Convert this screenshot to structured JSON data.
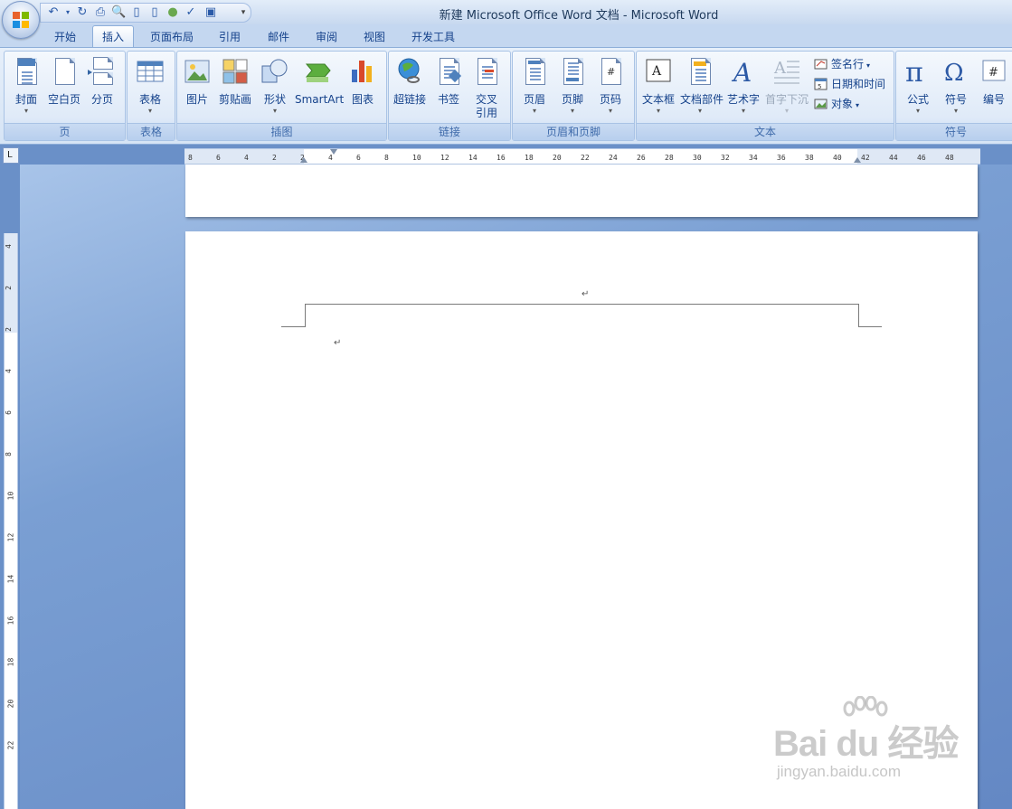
{
  "window": {
    "title": "新建 Microsoft Office Word 文档 - Microsoft Word"
  },
  "tabs": [
    {
      "label": "开始",
      "active": false
    },
    {
      "label": "插入",
      "active": true
    },
    {
      "label": "页面布局",
      "active": false
    },
    {
      "label": "引用",
      "active": false
    },
    {
      "label": "邮件",
      "active": false
    },
    {
      "label": "审阅",
      "active": false
    },
    {
      "label": "视图",
      "active": false
    },
    {
      "label": "开发工具",
      "active": false
    }
  ],
  "ribbon": {
    "groups": {
      "page": {
        "label": "页",
        "buttons": {
          "cover": "封面",
          "blank": "空白页",
          "break": "分页"
        }
      },
      "table": {
        "label": "表格",
        "buttons": {
          "table": "表格"
        }
      },
      "illustrations": {
        "label": "插图",
        "buttons": {
          "picture": "图片",
          "clipart": "剪贴画",
          "shapes": "形状",
          "smartart": "SmartArt",
          "chart": "图表"
        }
      },
      "links": {
        "label": "链接",
        "buttons": {
          "hyperlink": "超链接",
          "bookmark": "书签",
          "crossref_1": "交叉",
          "crossref_2": "引用"
        }
      },
      "header_footer": {
        "label": "页眉和页脚",
        "buttons": {
          "header": "页眉",
          "footer": "页脚",
          "page_number": "页码"
        }
      },
      "text": {
        "label": "文本",
        "buttons": {
          "textbox": "文本框",
          "quickparts": "文档部件",
          "wordart": "艺术字",
          "dropcap": "首字下沉",
          "signature": "签名行",
          "datetime": "日期和时间",
          "object": "对象"
        }
      },
      "symbols": {
        "label": "符号",
        "buttons": {
          "equation": "公式",
          "symbol": "符号",
          "number": "编号"
        }
      }
    }
  },
  "ruler": {
    "horizontal": [
      "8",
      "6",
      "4",
      "2",
      "2",
      "4",
      "6",
      "8",
      "10",
      "12",
      "14",
      "16",
      "18",
      "20",
      "22",
      "24",
      "26",
      "28",
      "30",
      "32",
      "34",
      "36",
      "38",
      "40",
      "42",
      "44",
      "46",
      "48"
    ],
    "vertical": [
      "4",
      "2",
      "2",
      "4",
      "6",
      "8",
      "10",
      "12",
      "14",
      "16",
      "18",
      "20",
      "22"
    ]
  },
  "document": {
    "para_mark": "↵"
  },
  "watermark": {
    "main": "Bai du 经验",
    "sub": "jingyan.baidu.com"
  },
  "colors": {
    "accent": "#15428b",
    "ribbon_bg": "#dfeaf8",
    "workspace": "#6a90c8"
  }
}
